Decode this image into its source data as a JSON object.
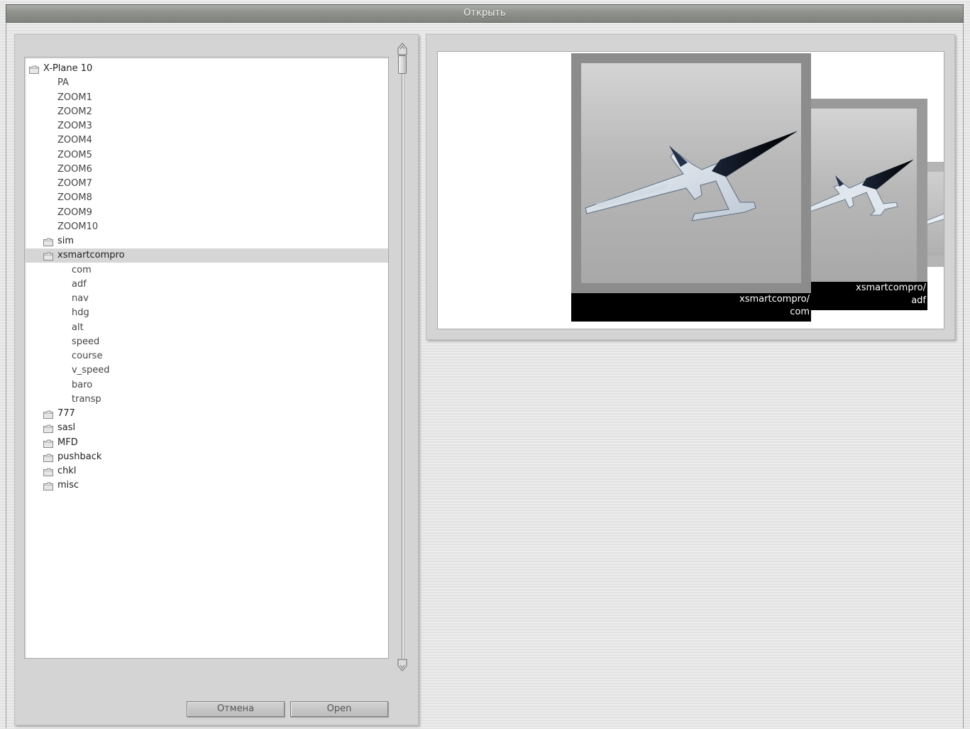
{
  "window": {
    "title": "Открыть"
  },
  "tree": {
    "items": [
      {
        "label": "X-Plane 10",
        "type": "folder",
        "depth": 0
      },
      {
        "label": "PA",
        "type": "leaf",
        "depth": 2
      },
      {
        "label": "ZOOM1",
        "type": "leaf",
        "depth": 2
      },
      {
        "label": "ZOOM2",
        "type": "leaf",
        "depth": 2
      },
      {
        "label": "ZOOM3",
        "type": "leaf",
        "depth": 2
      },
      {
        "label": "ZOOM4",
        "type": "leaf",
        "depth": 2
      },
      {
        "label": "ZOOM5",
        "type": "leaf",
        "depth": 2
      },
      {
        "label": "ZOOM6",
        "type": "leaf",
        "depth": 2
      },
      {
        "label": "ZOOM7",
        "type": "leaf",
        "depth": 2
      },
      {
        "label": "ZOOM8",
        "type": "leaf",
        "depth": 2
      },
      {
        "label": "ZOOM9",
        "type": "leaf",
        "depth": 2
      },
      {
        "label": "ZOOM10",
        "type": "leaf",
        "depth": 2
      },
      {
        "label": "sim",
        "type": "folder",
        "depth": 1
      },
      {
        "label": "xsmartcompro",
        "type": "folder",
        "depth": 1,
        "selected": true
      },
      {
        "label": "com",
        "type": "leaf",
        "depth": 3
      },
      {
        "label": "adf",
        "type": "leaf",
        "depth": 3
      },
      {
        "label": "nav",
        "type": "leaf",
        "depth": 3
      },
      {
        "label": "hdg",
        "type": "leaf",
        "depth": 3
      },
      {
        "label": "alt",
        "type": "leaf",
        "depth": 3
      },
      {
        "label": "speed",
        "type": "leaf",
        "depth": 3
      },
      {
        "label": "course",
        "type": "leaf",
        "depth": 3
      },
      {
        "label": "v_speed",
        "type": "leaf",
        "depth": 3
      },
      {
        "label": "baro",
        "type": "leaf",
        "depth": 3
      },
      {
        "label": "transp",
        "type": "leaf",
        "depth": 3
      },
      {
        "label": "777",
        "type": "folder",
        "depth": 1
      },
      {
        "label": "sasl",
        "type": "folder",
        "depth": 1
      },
      {
        "label": "MFD",
        "type": "folder",
        "depth": 1
      },
      {
        "label": "pushback",
        "type": "folder",
        "depth": 1
      },
      {
        "label": "chkl",
        "type": "folder",
        "depth": 1
      },
      {
        "label": "misc",
        "type": "folder",
        "depth": 1
      }
    ]
  },
  "buttons": {
    "cancel": "Отмена",
    "open": "Open"
  },
  "preview": {
    "cards": [
      {
        "caption_line1": "xsmartcompro/",
        "caption_line2": "com"
      },
      {
        "caption_line1": "xsmartcompro/",
        "caption_line2": "adf"
      }
    ]
  },
  "colors": {
    "selection": "#d6d6d6",
    "panel": "#d4d4d4",
    "titlebar": "#8e918c"
  },
  "icons": {
    "folder": "folder-icon",
    "scroll_up": "scroll-up-arrow-icon",
    "scroll_down": "scroll-down-arrow-icon",
    "airplane": "airplane-icon"
  }
}
